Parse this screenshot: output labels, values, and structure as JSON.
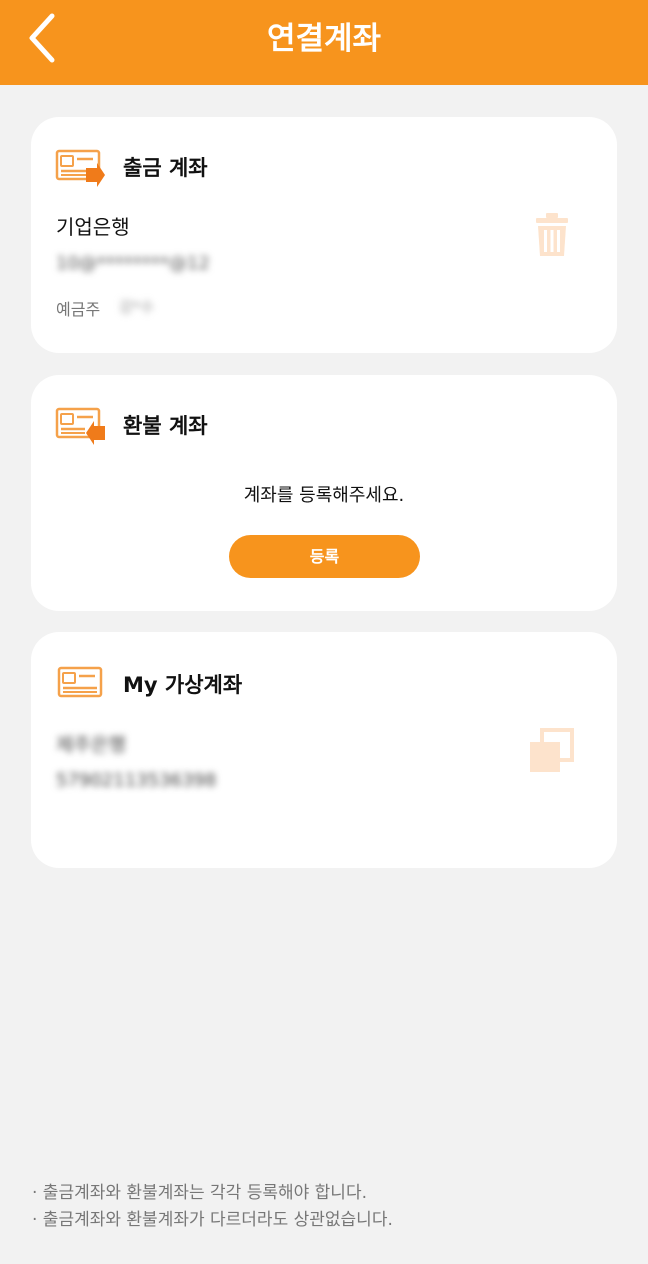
{
  "header": {
    "title": "연결계좌",
    "back_icon": "chevron-left-icon",
    "background": "#f7941d"
  },
  "withdraw_account": {
    "title": "출금 계좌",
    "bank_name": "기업은행",
    "account_number_masked": "10@********@12",
    "holder_label": "예금주",
    "holder_name_masked": "강*수",
    "delete_icon": "trash-icon"
  },
  "refund_account": {
    "title": "환불 계좌",
    "empty_message": "계좌를 등록해주세요.",
    "register_button": "등록"
  },
  "virtual_account": {
    "title": "My 가상계좌",
    "bank_name_masked": "제주은행",
    "account_number_masked": "57902113536398",
    "copy_icon": "copy-icon"
  },
  "notes": [
    "· 출금계좌와 환불계좌는 각각 등록해야 합니다.",
    "· 출금계좌와 환불계좌가 다르더라도 상관없습니다."
  ]
}
